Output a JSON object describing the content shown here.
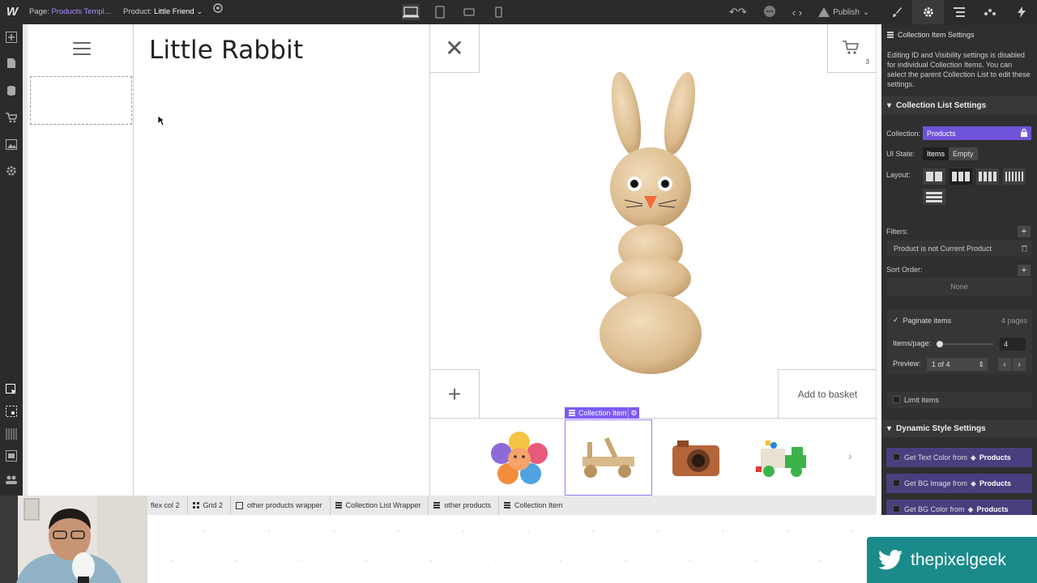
{
  "topbar": {
    "logo": "W",
    "page_label": "Page:",
    "page_value": "Products Templ...",
    "product_label": "Product:",
    "product_value": "Little Friend",
    "publish": "Publish"
  },
  "canvas": {
    "title": "Little Rabbit",
    "cart_count": "3",
    "add_to_basket": "Add to basket",
    "collection_item_label": "Collection Item"
  },
  "breadcrumbs": [
    {
      "label": "flex col 2",
      "icon": "none"
    },
    {
      "label": "Grid 2",
      "icon": "grid-icon"
    },
    {
      "label": "other products wrapper",
      "icon": "box-icon"
    },
    {
      "label": "Collection List Wrapper",
      "icon": "collection-icon"
    },
    {
      "label": "other products",
      "icon": "collection-icon"
    },
    {
      "label": "Collection Item",
      "icon": "collection-icon"
    }
  ],
  "panel": {
    "header": "Collection Item Settings",
    "note": "Editing ID and Visibility settings is disabled for individual Collection Items. You can select the parent Collection List to edit these settings.",
    "list_settings_title": "Collection List Settings",
    "collection_label": "Collection:",
    "collection_value": "Products",
    "ui_state_label": "UI State:",
    "ui_state_items": "Items",
    "ui_state_empty": "Empty",
    "layout_label": "Layout:",
    "filters_label": "Filters:",
    "filter_item": "Product is not Current Product",
    "sort_label": "Sort Order:",
    "sort_value": "None",
    "paginate_label": "Paginate items",
    "paginate_pages": "4 pages",
    "items_per_page_label": "Items/page:",
    "items_per_page_value": "4",
    "preview_label": "Preview:",
    "preview_value": "1 of 4",
    "limit_label": "Limit items",
    "dynamic_title": "Dynamic Style Settings",
    "dyn_text": "Get Text Color from",
    "dyn_bg_image": "Get BG Image from",
    "dyn_bg_color": "Get BG Color from",
    "dyn_source": "Products"
  },
  "banner": {
    "handle": "thepixelgeek"
  },
  "colors": {
    "accent": "#7c5cf2",
    "banner": "#1a8a8a",
    "dark_ui": "#2b2b2b"
  }
}
